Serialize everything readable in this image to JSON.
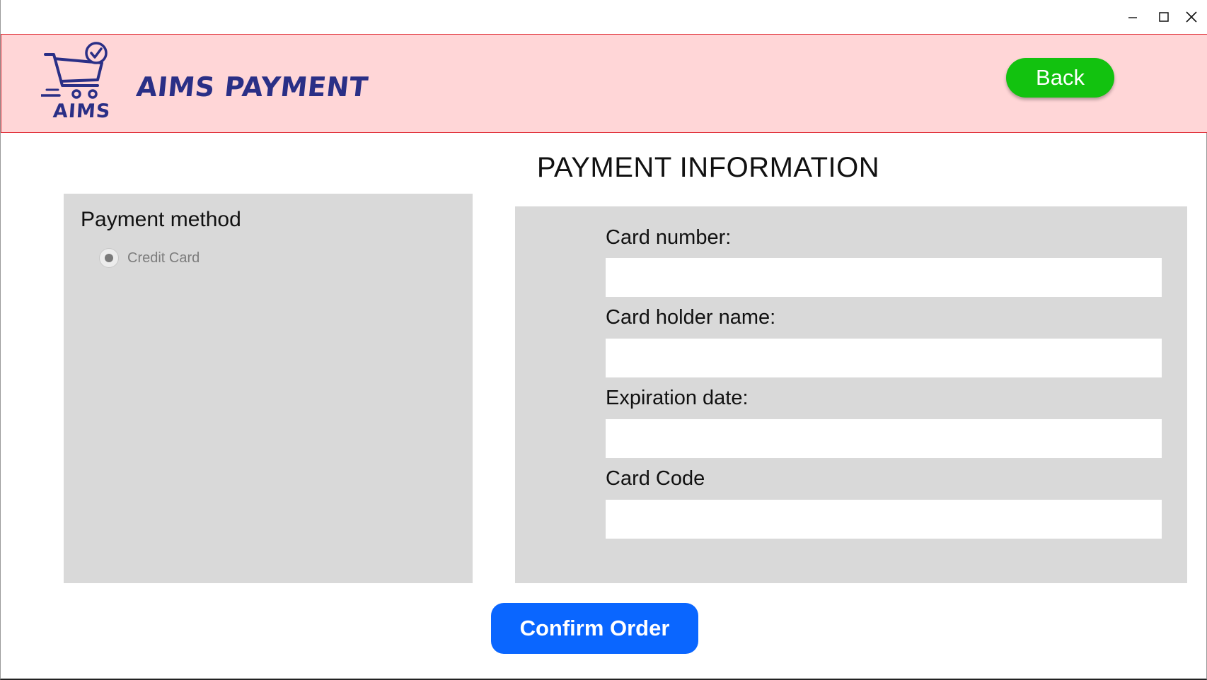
{
  "window": {
    "controls": {
      "minimize_icon": "minimize-icon",
      "maximize_icon": "maximize-icon",
      "close_icon": "close-icon"
    }
  },
  "header": {
    "logo_text": "AIMS",
    "title": "AIMS PAYMENT",
    "back_label": "Back",
    "background_color": "#ffd6d7",
    "border_color": "#e0313a",
    "brand_color": "#2a2f86",
    "back_color": "#12c20f"
  },
  "page": {
    "title": "PAYMENT INFORMATION"
  },
  "payment_method": {
    "heading": "Payment method",
    "options": [
      {
        "label": "Credit Card",
        "selected": true,
        "disabled": true
      }
    ]
  },
  "form": {
    "fields": [
      {
        "label": "Card number:",
        "value": ""
      },
      {
        "label": "Card holder name:",
        "value": ""
      },
      {
        "label": "Expiration date:",
        "value": ""
      },
      {
        "label": "Card Code",
        "value": ""
      }
    ]
  },
  "actions": {
    "confirm_label": "Confirm Order",
    "confirm_color": "#0a66ff"
  }
}
